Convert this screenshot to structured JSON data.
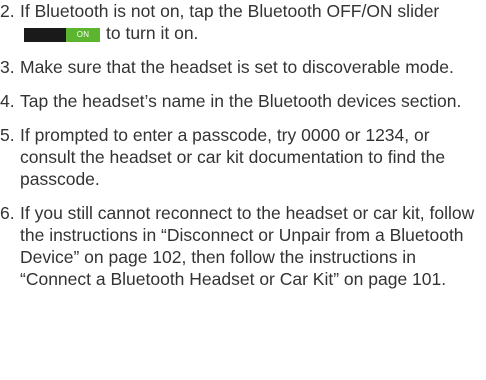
{
  "steps": [
    {
      "number": "2.",
      "text_before": "If Bluetooth is not on, tap the Bluetooth OFF/ON slider",
      "toggle_label": "ON",
      "text_after": "to turn it on."
    },
    {
      "number": "3.",
      "text": "Make sure that the headset is set to discoverable mode."
    },
    {
      "number": "4.",
      "text": "Tap the headset’s name in the Bluetooth devices section."
    },
    {
      "number": "5.",
      "text": "If prompted to enter a passcode, try 0000 or 1234, or consult the headset or car kit documentation to find the passcode."
    },
    {
      "number": "6.",
      "text": "If you still cannot reconnect to the headset or car kit, follow the instructions in “Disconnect or Unpair from a Bluetooth Device” on page 102, then follow the instructions in “Connect a Bluetooth Headset or Car Kit” on page 101."
    }
  ],
  "colors": {
    "text": "#333333",
    "toggle_track": "#1a1a1a",
    "toggle_on": "#5cb52e"
  }
}
